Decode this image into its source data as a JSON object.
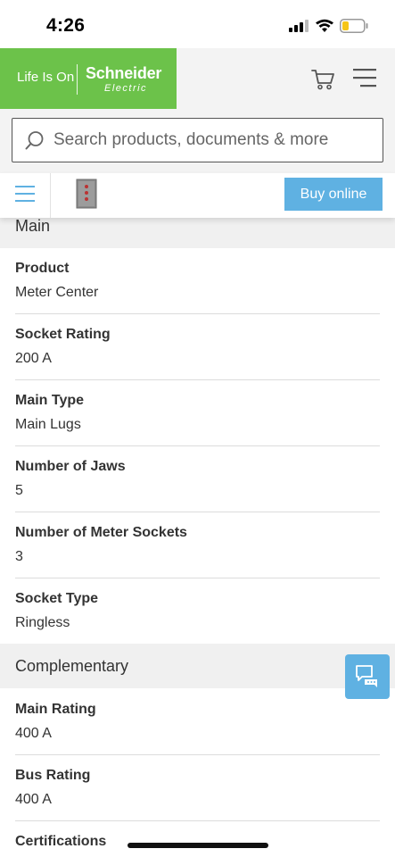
{
  "status": {
    "time": "4:26"
  },
  "brand": {
    "tagline": "Life Is On",
    "name": "Schneider",
    "subname": "Electric",
    "color": "#6cc24a"
  },
  "header": {
    "cart_icon": "cart-icon",
    "menu_icon": "menu-icon"
  },
  "search": {
    "placeholder": "Search products, documents & more"
  },
  "product_bar": {
    "buy_label": "Buy online",
    "accent": "#5fb1e2"
  },
  "sections": [
    {
      "title": "Main",
      "specs": [
        {
          "label": "Product",
          "value": "Meter Center"
        },
        {
          "label": "Socket Rating",
          "value": "200 A"
        },
        {
          "label": "Main Type",
          "value": "Main Lugs"
        },
        {
          "label": "Number of Jaws",
          "value": "5"
        },
        {
          "label": "Number of Meter Sockets",
          "value": "3"
        },
        {
          "label": "Socket Type",
          "value": "Ringless"
        }
      ]
    },
    {
      "title": "Complementary",
      "specs": [
        {
          "label": "Main Rating",
          "value": "400 A"
        },
        {
          "label": "Bus Rating",
          "value": "400 A"
        },
        {
          "label": "Certifications",
          "value": ""
        }
      ]
    }
  ]
}
